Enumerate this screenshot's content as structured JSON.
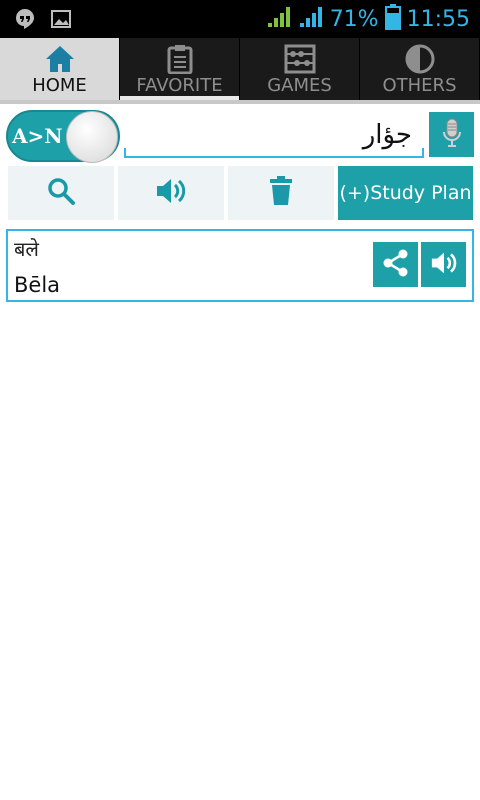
{
  "statusbar": {
    "battery_percent": "71%",
    "time": "11:55",
    "icons": [
      "hangouts-icon",
      "image-icon",
      "signal-green-icon",
      "signal-blue-icon",
      "battery-icon"
    ]
  },
  "tabs": [
    {
      "label": "HOME",
      "icon": "home-icon",
      "active": true
    },
    {
      "label": "FAVORITE",
      "icon": "clipboard-icon",
      "active": false
    },
    {
      "label": "GAMES",
      "icon": "abacus-icon",
      "active": false
    },
    {
      "label": "OTHERS",
      "icon": "half-circle-icon",
      "active": false
    }
  ],
  "search": {
    "toggle_label": "A>N",
    "value": "جؤار",
    "placeholder": "",
    "mic_icon": "microphone-icon"
  },
  "actions": {
    "search_icon": "search-icon",
    "speak_icon": "speaker-icon",
    "delete_icon": "trash-icon",
    "study_plan_label": "(+)Study Plan"
  },
  "result": {
    "word": "बले",
    "transliteration": "Bēla",
    "share_icon": "share-icon",
    "speaker_icon": "speaker-icon"
  },
  "colors": {
    "accent": "#1ea0a8",
    "underline": "#33b5e5",
    "status_text": "#33b5e5"
  }
}
